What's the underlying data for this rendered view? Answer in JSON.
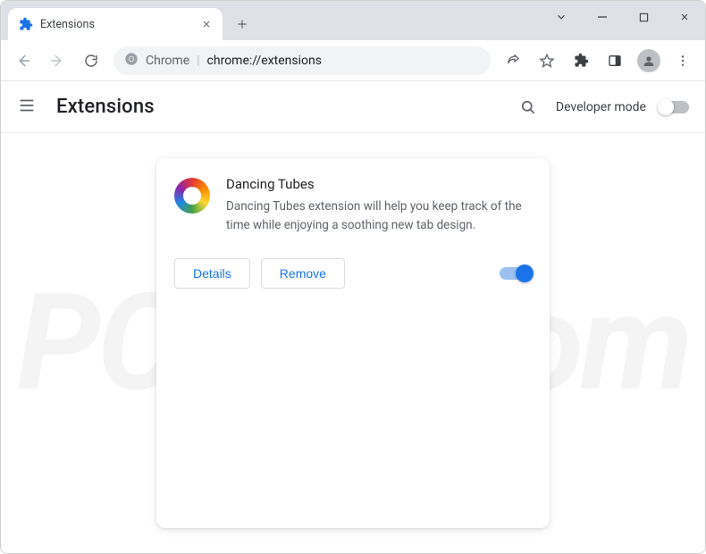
{
  "tab": {
    "title": "Extensions"
  },
  "omnibox": {
    "prefix": "Chrome",
    "path": "chrome://extensions"
  },
  "page": {
    "title": "Extensions",
    "dev_mode_label": "Developer mode"
  },
  "extension": {
    "name": "Dancing Tubes",
    "description": "Dancing Tubes extension will help you keep track of the time while enjoying a soothing new tab design.",
    "details_label": "Details",
    "remove_label": "Remove",
    "enabled": true
  },
  "watermark": "PC risk.com"
}
